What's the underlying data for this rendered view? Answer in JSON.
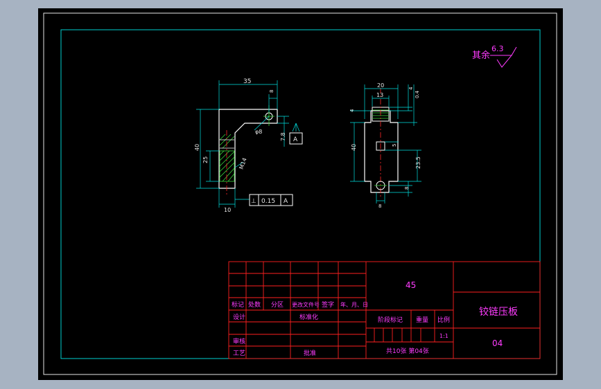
{
  "colors": {
    "background": "#a7b3c2",
    "sheet": "#000000",
    "inner_border": "#00d0d0",
    "outer_border": "#ffffff",
    "part_lines": "#ffffff",
    "dimension_lines": "#00e0e0",
    "title_block_lines": "#ff2020",
    "text": "#ff3cff",
    "centerlines": "#ff2a2a",
    "hatch": "#3bd63b"
  },
  "roughness": {
    "label": "其余",
    "value": "6.3"
  },
  "title_block": {
    "material": "45",
    "part_name": "铰链压板",
    "drawing_no": "04",
    "scale": "1:1",
    "sheets": "共10张  第04张",
    "labels": {
      "mark": "标记",
      "count": "处数",
      "zone": "分区",
      "change_doc": "更改文件号",
      "signature": "签字",
      "date": "年、月、日",
      "design": "设计",
      "standardize": "标准化",
      "review": "审核",
      "process": "工艺",
      "approve": "批准",
      "stage_mark": "阶段标记",
      "weight": "重量",
      "scale": "比例"
    }
  },
  "front_view": {
    "dims": {
      "width_top": "35",
      "hole_offset": "8",
      "hole_dia": "φ8",
      "hole_height": "7.8",
      "height_total": "40",
      "height_thread": "25",
      "thread": "M14",
      "bottom_width": "10"
    },
    "datum": "A",
    "tolerance_frame": {
      "symbol": "⊥",
      "value": "0.15",
      "datum": "A"
    }
  },
  "side_view": {
    "dims": {
      "top_width": "20",
      "slot_width": "13",
      "depth_top": "4",
      "chamfer": "0.4",
      "left_height": "40",
      "step": "4",
      "small_square": "5",
      "lower_h": "23.5",
      "bottom": "8",
      "bottom_w": "8"
    }
  }
}
